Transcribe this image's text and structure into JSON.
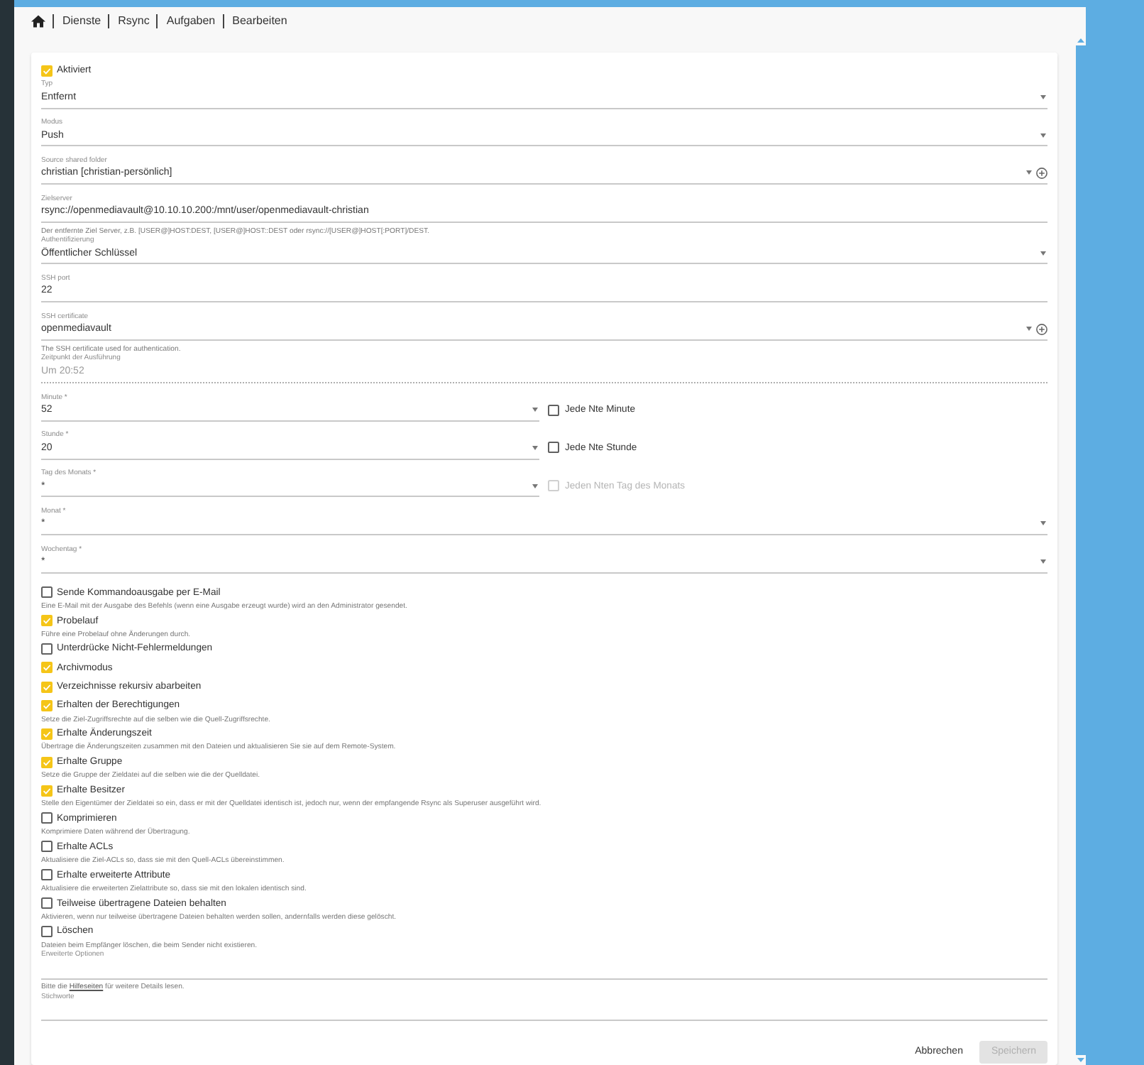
{
  "breadcrumb": [
    {
      "label": "Dienste"
    },
    {
      "label": "Rsync"
    },
    {
      "label": "Aufgaben"
    },
    {
      "label": "Bearbeiten"
    }
  ],
  "form": {
    "enabled": {
      "label": "Aktiviert",
      "checked": true
    },
    "fields": [
      {
        "kind": "select",
        "label": "Typ",
        "value": "Entfernt"
      },
      {
        "kind": "select",
        "label": "Modus",
        "value": "Push"
      },
      {
        "kind": "select_add",
        "label": "Source shared folder",
        "value": "christian [christian-persönlich]"
      },
      {
        "kind": "text",
        "label": "Zielserver",
        "value": "rsync://openmediavault@10.10.10.200:/mnt/user/openmediavault-christian",
        "hint": "Der entfernte Ziel Server, z.B. [USER@]HOST:DEST, [USER@]HOST::DEST oder rsync://[USER@]HOST[:PORT]/DEST."
      },
      {
        "kind": "select",
        "label": "Authentifizierung",
        "value": "Öffentlicher Schlüssel"
      },
      {
        "kind": "text",
        "label": "SSH port",
        "value": "22"
      },
      {
        "kind": "select_add",
        "label": "SSH certificate",
        "value": "openmediavault",
        "hint": "The SSH certificate used for authentication."
      },
      {
        "kind": "readonly",
        "label": "Zeitpunkt der Ausführung",
        "value": "Um 20:52"
      },
      {
        "kind": "select_check",
        "label": "Minute *",
        "value": "52",
        "option": {
          "label": "Jede Nte Minute",
          "checked": false,
          "disabled": false
        }
      },
      {
        "kind": "select_check",
        "label": "Stunde *",
        "value": "20",
        "option": {
          "label": "Jede Nte Stunde",
          "checked": false,
          "disabled": false
        }
      },
      {
        "kind": "select_check",
        "label": "Tag des Monats *",
        "value": "*",
        "option": {
          "label": "Jeden Nten Tag des Monats",
          "checked": false,
          "disabled": true
        }
      },
      {
        "kind": "select",
        "label": "Monat *",
        "value": "*"
      },
      {
        "kind": "select",
        "label": "Wochentag *",
        "value": "*"
      }
    ],
    "options": [
      {
        "label": "Sende Kommandoausgabe per E-Mail",
        "checked": false,
        "hint": "Eine E-Mail mit der Ausgabe des Befehls (wenn eine Ausgabe erzeugt wurde) wird an den Administrator gesendet."
      },
      {
        "label": "Probelauf",
        "checked": true,
        "hint": "Führe eine Probelauf ohne Änderungen durch."
      },
      {
        "label": "Unterdrücke Nicht-Fehlermeldungen",
        "checked": false
      },
      {
        "label": "Archivmodus",
        "checked": true
      },
      {
        "label": "Verzeichnisse rekursiv abarbeiten",
        "checked": true
      },
      {
        "label": "Erhalten der Berechtigungen",
        "checked": true,
        "hint": "Setze die Ziel-Zugriffsrechte auf die selben wie die Quell-Zugriffsrechte."
      },
      {
        "label": "Erhalte Änderungszeit",
        "checked": true,
        "hint": "Übertrage die Änderungszeiten zusammen mit den Dateien und aktualisieren Sie sie auf dem Remote-System."
      },
      {
        "label": "Erhalte Gruppe",
        "checked": true,
        "hint": "Setze die Gruppe der Zieldatei auf die selben wie die der Quelldatei."
      },
      {
        "label": "Erhalte Besitzer",
        "checked": true,
        "hint": "Stelle den Eigentümer der Zieldatei so ein, dass er mit der Quelldatei identisch ist, jedoch nur, wenn der empfangende Rsync als Superuser ausgeführt wird."
      },
      {
        "label": "Komprimieren",
        "checked": false,
        "hint": "Komprimiere Daten während der Übertragung."
      },
      {
        "label": "Erhalte ACLs",
        "checked": false,
        "hint": "Aktualisiere die Ziel-ACLs so, dass sie mit den Quell-ACLs übereinstimmen."
      },
      {
        "label": "Erhalte erweiterte Attribute",
        "checked": false,
        "hint": "Aktualisiere die erweiterten Zielattribute so, dass sie mit den lokalen identisch sind."
      },
      {
        "label": "Teilweise übertragene Dateien behalten",
        "checked": false,
        "hint": "Aktivieren, wenn nur teilweise übertragene Dateien behalten werden sollen, andernfalls werden diese gelöscht."
      },
      {
        "label": "Löschen",
        "checked": false,
        "hint": "Dateien beim Empfänger löschen, die beim Sender nicht existieren."
      }
    ],
    "extra_fields": [
      {
        "kind": "text",
        "label": "Erweiterte Optionen",
        "hint": {
          "before": "Bitte die ",
          "link": "Hilfeseiten",
          "after": " für weitere Details lesen."
        }
      },
      {
        "kind": "text",
        "label": "Stichworte"
      }
    ]
  },
  "buttons": [
    {
      "kind": "text",
      "label": "Abbrechen",
      "disabled": false
    },
    {
      "kind": "raised",
      "label": "Speichern",
      "disabled": true
    }
  ]
}
